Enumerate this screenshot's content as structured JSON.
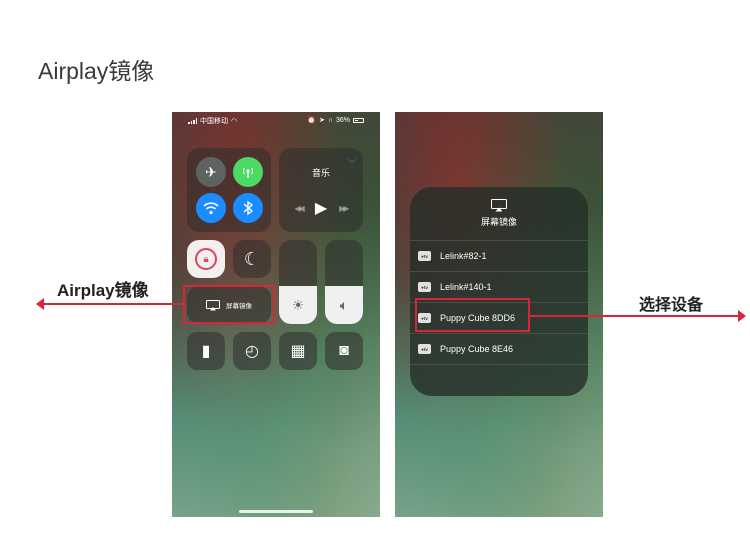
{
  "page": {
    "title": "Airplay镜像"
  },
  "status_bar": {
    "carrier": "中国移动",
    "battery": "36%"
  },
  "control_center": {
    "music_title": "音乐",
    "screen_mirroring_label": "屏幕镜像"
  },
  "mirror_popup": {
    "title": "屏幕镜像",
    "tv_badge": "●tv",
    "devices": [
      {
        "name": "Lelink#82-1"
      },
      {
        "name": "Lelink#140-1"
      },
      {
        "name": "Puppy Cube 8DD6"
      },
      {
        "name": "Puppy Cube 8E46"
      }
    ]
  },
  "annotations": {
    "left_label": "Airplay镜像",
    "right_label": "选择设备",
    "highlight_color": "#d9253a"
  },
  "icons": [
    "airplane-icon",
    "cellular-icon",
    "wifi-icon",
    "bluetooth-icon",
    "airplay-icon",
    "rotation-lock-icon",
    "moon-icon",
    "brightness-icon",
    "volume-icon",
    "flashlight-icon",
    "timer-icon",
    "calculator-icon",
    "camera-icon",
    "apple-tv-icon"
  ]
}
